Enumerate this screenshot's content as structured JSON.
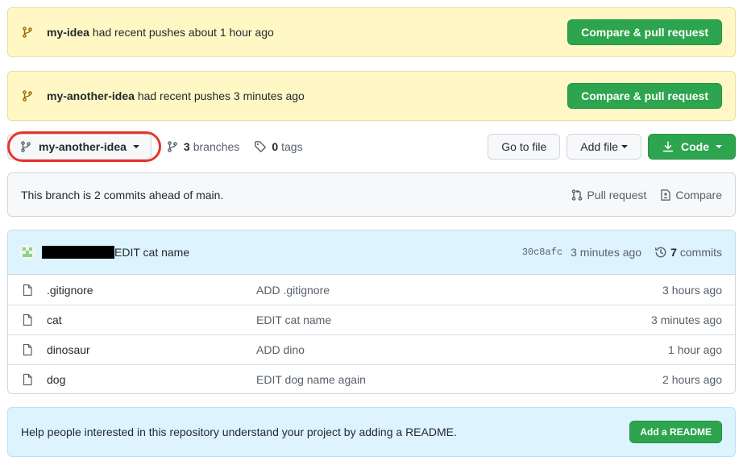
{
  "banners": [
    {
      "branch": "my-idea",
      "message": "had recent pushes about 1 hour ago",
      "button": "Compare & pull request"
    },
    {
      "branch": "my-another-idea",
      "message": "had recent pushes 3 minutes ago",
      "button": "Compare & pull request"
    }
  ],
  "toolbar": {
    "branch": "my-another-idea",
    "branches_count": "3",
    "branches_label": "branches",
    "tags_count": "0",
    "tags_label": "tags",
    "go_to_file": "Go to file",
    "add_file": "Add file",
    "code": "Code"
  },
  "ahead": {
    "message": "This branch is 2 commits ahead of main.",
    "pull_request": "Pull request",
    "compare": "Compare"
  },
  "commit": {
    "message": "EDIT cat name",
    "sha": "30c8afc",
    "time": "3 minutes ago",
    "count": "7",
    "count_label": "commits"
  },
  "files": [
    {
      "name": ".gitignore",
      "message": "ADD .gitignore",
      "age": "3 hours ago"
    },
    {
      "name": "cat",
      "message": "EDIT cat name",
      "age": "3 minutes ago"
    },
    {
      "name": "dinosaur",
      "message": "ADD dino",
      "age": "1 hour ago"
    },
    {
      "name": "dog",
      "message": "EDIT dog name again",
      "age": "2 hours ago"
    }
  ],
  "readme": {
    "message": "Help people interested in this repository understand your project by adding a README.",
    "button": "Add a README"
  },
  "colors": {
    "accent_green": "#2da44e",
    "banner_yellow": "#fff8c5",
    "highlight_red": "#e8332a",
    "info_blue": "#ddf4ff"
  },
  "icons": {
    "branch": "git-branch-icon",
    "tag": "tag-icon",
    "file": "file-icon",
    "download": "download-icon",
    "pull_request": "git-pull-request-icon",
    "compare": "diff-icon",
    "history": "history-icon"
  }
}
